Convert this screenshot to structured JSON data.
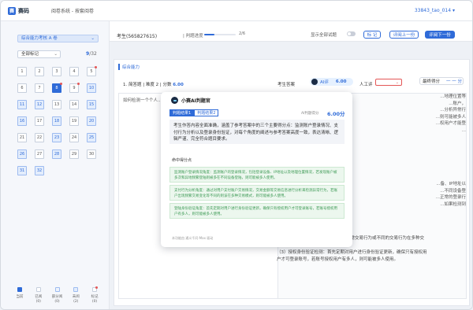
{
  "app": {
    "logo_glyph": "赛",
    "logo_text": "赛码",
    "system_title": "阅卷系统 - 按套阅卷",
    "user": "33843_tao_014 ▾"
  },
  "left": {
    "paper_select": "综合能力考核 A 卷",
    "mark_select": "全部标记",
    "progress_current": "9",
    "progress_total": "/32",
    "questions": [
      {
        "n": "1",
        "state": "plain"
      },
      {
        "n": "2",
        "state": "plain"
      },
      {
        "n": "3",
        "state": "plain"
      },
      {
        "n": "4",
        "state": "plain"
      },
      {
        "n": "5",
        "state": "flag"
      },
      {
        "n": "6",
        "state": "plain"
      },
      {
        "n": "7",
        "state": "plain"
      },
      {
        "n": "8",
        "state": "current"
      },
      {
        "n": "9",
        "state": "flag"
      },
      {
        "n": "10",
        "state": "done"
      },
      {
        "n": "11",
        "state": "done"
      },
      {
        "n": "12",
        "state": "done"
      },
      {
        "n": "13",
        "state": "plain"
      },
      {
        "n": "14",
        "state": "plain"
      },
      {
        "n": "15",
        "state": "done"
      },
      {
        "n": "16",
        "state": "done"
      },
      {
        "n": "17",
        "state": "plain"
      },
      {
        "n": "18",
        "state": "done"
      },
      {
        "n": "19",
        "state": "plain"
      },
      {
        "n": "20",
        "state": "done"
      },
      {
        "n": "21",
        "state": "plain"
      },
      {
        "n": "22",
        "state": "plain"
      },
      {
        "n": "23",
        "state": "done"
      },
      {
        "n": "24",
        "state": "plain"
      },
      {
        "n": "25",
        "state": "done"
      },
      {
        "n": "26",
        "state": "done"
      },
      {
        "n": "27",
        "state": "plain"
      },
      {
        "n": "28",
        "state": "done"
      },
      {
        "n": "29",
        "state": "plain"
      },
      {
        "n": "30",
        "state": "plain"
      },
      {
        "n": "31",
        "state": "done"
      },
      {
        "n": "32",
        "state": "done"
      }
    ],
    "legend": [
      {
        "label": "当前",
        "count": "",
        "kind": "current"
      },
      {
        "label": "已阅",
        "count": "(0)",
        "kind": "plain"
      },
      {
        "label": "部分阅",
        "count": "(0)",
        "kind": "partial"
      },
      {
        "label": "未阅",
        "count": "(2)",
        "kind": "done"
      },
      {
        "label": "标记",
        "count": "(0)",
        "kind": "flag"
      }
    ]
  },
  "scorebar": {
    "examinee": "考生(565827615)",
    "progress_label": "| 判题进度",
    "progress_value": "2/6",
    "progress_fraction": 0.333,
    "show_all": "显示全部试题",
    "btn_mark": "标 记",
    "btn_prev": "评阅上一份",
    "btn_next": "评阅下一份"
  },
  "question": {
    "section": "综合能力",
    "type_label": "1. 简答题",
    "difficulty": "| 难度 2 |",
    "score_label": "分数",
    "score_value": "6.00",
    "answer_label": "考生答案",
    "ai_label": "AI评",
    "ai_score": "6.00",
    "manual_label": "人工评",
    "final_label": "最终得分",
    "final_value": "一 一 分",
    "student_answer": "如何检测一个个人...",
    "ref_top": [
      "...地理位置等",
      "...账户，",
      "...分析异常行",
      "...则可能被多人",
      "...权用户才能登",
      "..."
    ],
    "ref_mid": [
      "...备、IP地址以",
      "...不同设备登",
      "...正常的登录行",
      "...如果检测到"
    ],
    "ref_bottom": [
      "账户可能被多人使用",
      "统行为特征，如交易信息",
      "统计分析检测异常行为，若账户出现异常交易行为或不同的交易行为在多种交",
      "易模式，则可能被多人使用。",
      "（3）授权身份验证检测：首先定期对用户进行身份验证更新，确保只有授权用",
      "户才可登录账号，若账号授权用户有多人，则可能被多人使用。"
    ]
  },
  "modal": {
    "title": "小赛AI判题官",
    "tab1": "判题结果1",
    "tab2": "判题结果2",
    "score_label": "AI判题得分",
    "score_value": "6.00分",
    "summary": "考生作答内容全面准确，涵盖了参考答案中的三个主要得分点：监测账户登录情况、支付行为分析以及登录身份验证，对每个角度的阐述与参考答案高度一致，表达清晰、逻辑严谨、完全符合题目要求。",
    "points_title": "命中得分点",
    "points": [
      "监测账户登录情况角度：监测账户的登录情况，包括登录设备、IP地址以及地理位置情况，若发现账户被多次和异地频繁登陆则被多在不同设备登陆，则可能被多人使用。",
      "支付行为分析角度：通过对用户支付账户交易情况，交易金额等交易信息进行分析来检测异常行为，若账户出现频繁交易变化等不同的则该在多种交易模式，则可能被多人使用。",
      "登陆身份验证角度：首先定期对用户进行身份验证更新，确保只有授权用户才可登录账号，若账号授权用户有多人，则可能被多人使用。"
    ],
    "footer": "本功能由 通义千问-Max 驱动"
  },
  "colors": {
    "accent": "#2f6bd8",
    "flag": "#e45656",
    "hit_green": "#3d9a55"
  }
}
